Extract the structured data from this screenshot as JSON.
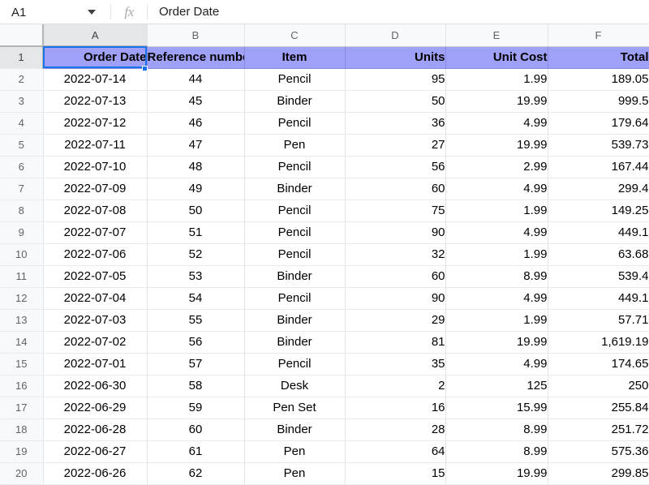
{
  "formula_bar": {
    "name_box_value": "A1",
    "chevron_icon": "chevron-down-icon",
    "fx_icon": "fx",
    "formula_value": "Order Date"
  },
  "grid": {
    "column_letters": [
      "A",
      "B",
      "C",
      "D",
      "E",
      "F"
    ],
    "active_column": "A",
    "active_row": "1",
    "selected_cell": "A1",
    "header_fill_color": "#9fa0f7",
    "selection_color": "#1a73e8",
    "row_numbers": [
      "1",
      "2",
      "3",
      "4",
      "5",
      "6",
      "7",
      "8",
      "9",
      "10",
      "11",
      "12",
      "13",
      "14",
      "15",
      "16",
      "17",
      "18",
      "19",
      "20"
    ],
    "header_row": {
      "A": "Order Date",
      "B": "Reference number",
      "C": "Item",
      "D": "Units",
      "E": "Unit Cost",
      "F": "Total"
    },
    "rows": [
      {
        "n": "2",
        "A": "2022-07-14",
        "B": "44",
        "C": "Pencil",
        "D": "95",
        "E": "1.99",
        "F": "189.05"
      },
      {
        "n": "3",
        "A": "2022-07-13",
        "B": "45",
        "C": "Binder",
        "D": "50",
        "E": "19.99",
        "F": "999.5"
      },
      {
        "n": "4",
        "A": "2022-07-12",
        "B": "46",
        "C": "Pencil",
        "D": "36",
        "E": "4.99",
        "F": "179.64"
      },
      {
        "n": "5",
        "A": "2022-07-11",
        "B": "47",
        "C": "Pen",
        "D": "27",
        "E": "19.99",
        "F": "539.73"
      },
      {
        "n": "6",
        "A": "2022-07-10",
        "B": "48",
        "C": "Pencil",
        "D": "56",
        "E": "2.99",
        "F": "167.44"
      },
      {
        "n": "7",
        "A": "2022-07-09",
        "B": "49",
        "C": "Binder",
        "D": "60",
        "E": "4.99",
        "F": "299.4"
      },
      {
        "n": "8",
        "A": "2022-07-08",
        "B": "50",
        "C": "Pencil",
        "D": "75",
        "E": "1.99",
        "F": "149.25"
      },
      {
        "n": "9",
        "A": "2022-07-07",
        "B": "51",
        "C": "Pencil",
        "D": "90",
        "E": "4.99",
        "F": "449.1"
      },
      {
        "n": "10",
        "A": "2022-07-06",
        "B": "52",
        "C": "Pencil",
        "D": "32",
        "E": "1.99",
        "F": "63.68"
      },
      {
        "n": "11",
        "A": "2022-07-05",
        "B": "53",
        "C": "Binder",
        "D": "60",
        "E": "8.99",
        "F": "539.4"
      },
      {
        "n": "12",
        "A": "2022-07-04",
        "B": "54",
        "C": "Pencil",
        "D": "90",
        "E": "4.99",
        "F": "449.1"
      },
      {
        "n": "13",
        "A": "2022-07-03",
        "B": "55",
        "C": "Binder",
        "D": "29",
        "E": "1.99",
        "F": "57.71"
      },
      {
        "n": "14",
        "A": "2022-07-02",
        "B": "56",
        "C": "Binder",
        "D": "81",
        "E": "19.99",
        "F": "1,619.19"
      },
      {
        "n": "15",
        "A": "2022-07-01",
        "B": "57",
        "C": "Pencil",
        "D": "35",
        "E": "4.99",
        "F": "174.65"
      },
      {
        "n": "16",
        "A": "2022-06-30",
        "B": "58",
        "C": "Desk",
        "D": "2",
        "E": "125",
        "F": "250"
      },
      {
        "n": "17",
        "A": "2022-06-29",
        "B": "59",
        "C": "Pen Set",
        "D": "16",
        "E": "15.99",
        "F": "255.84"
      },
      {
        "n": "18",
        "A": "2022-06-28",
        "B": "60",
        "C": "Binder",
        "D": "28",
        "E": "8.99",
        "F": "251.72"
      },
      {
        "n": "19",
        "A": "2022-06-27",
        "B": "61",
        "C": "Pen",
        "D": "64",
        "E": "8.99",
        "F": "575.36"
      },
      {
        "n": "20",
        "A": "2022-06-26",
        "B": "62",
        "C": "Pen",
        "D": "15",
        "E": "19.99",
        "F": "299.85"
      }
    ]
  }
}
